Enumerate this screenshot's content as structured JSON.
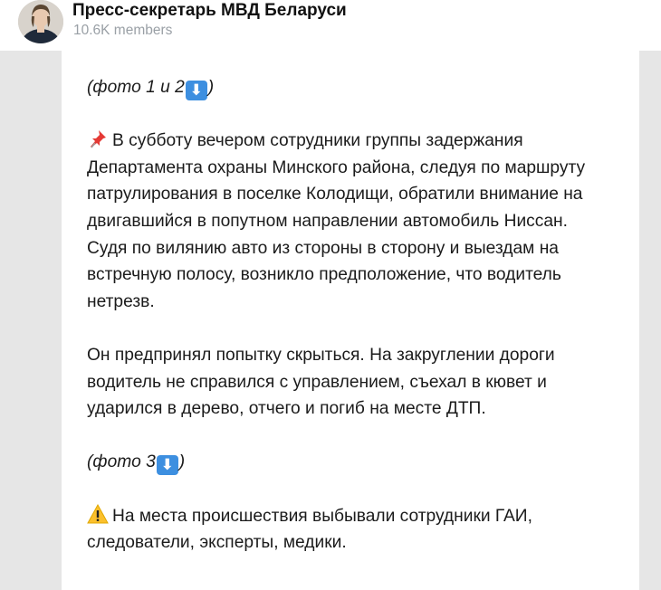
{
  "header": {
    "channel_name": "Пресс-секретарь МВД Беларуси",
    "members": "10.6K members"
  },
  "post": {
    "photo_1_2_text": "(фото 1 и 2",
    "photo_1_2_close": ")",
    "paragraph_1_lines": [
      "В субботу вечером сотрудники группы задержания",
      "Департамента охраны Минского района, следуя по маршруту",
      "патрулирования в поселке Колодищи, обратили внимание на",
      "двигавшийся в попутном направлении автомобиль Ниссан.",
      "Судя по вилянию авто из стороны в сторону и выездам на",
      "встречную полосу, возникло предположение, что водитель",
      "нетрезв."
    ],
    "paragraph_2_lines": [
      "Он предпринял попытку скрыться. На закруглении дороги",
      "водитель не справился с управлением, съехал в кювет и",
      "ударился в дерево, отчего и погиб на месте ДТП."
    ],
    "photo_3_text": "(фото 3",
    "photo_3_close": ")",
    "paragraph_3_lines": [
      "На места происшествия выбывали сотрудники ГАИ,",
      "следователи, эксперты, медики."
    ]
  },
  "icons": {
    "down_arrow": "⬇",
    "pin": "pin-icon",
    "warning": "warning-icon"
  },
  "colors": {
    "key_icon": "#3d8fe0",
    "chat_background": "#e6e6e6",
    "members_text": "#9aa0a6"
  }
}
